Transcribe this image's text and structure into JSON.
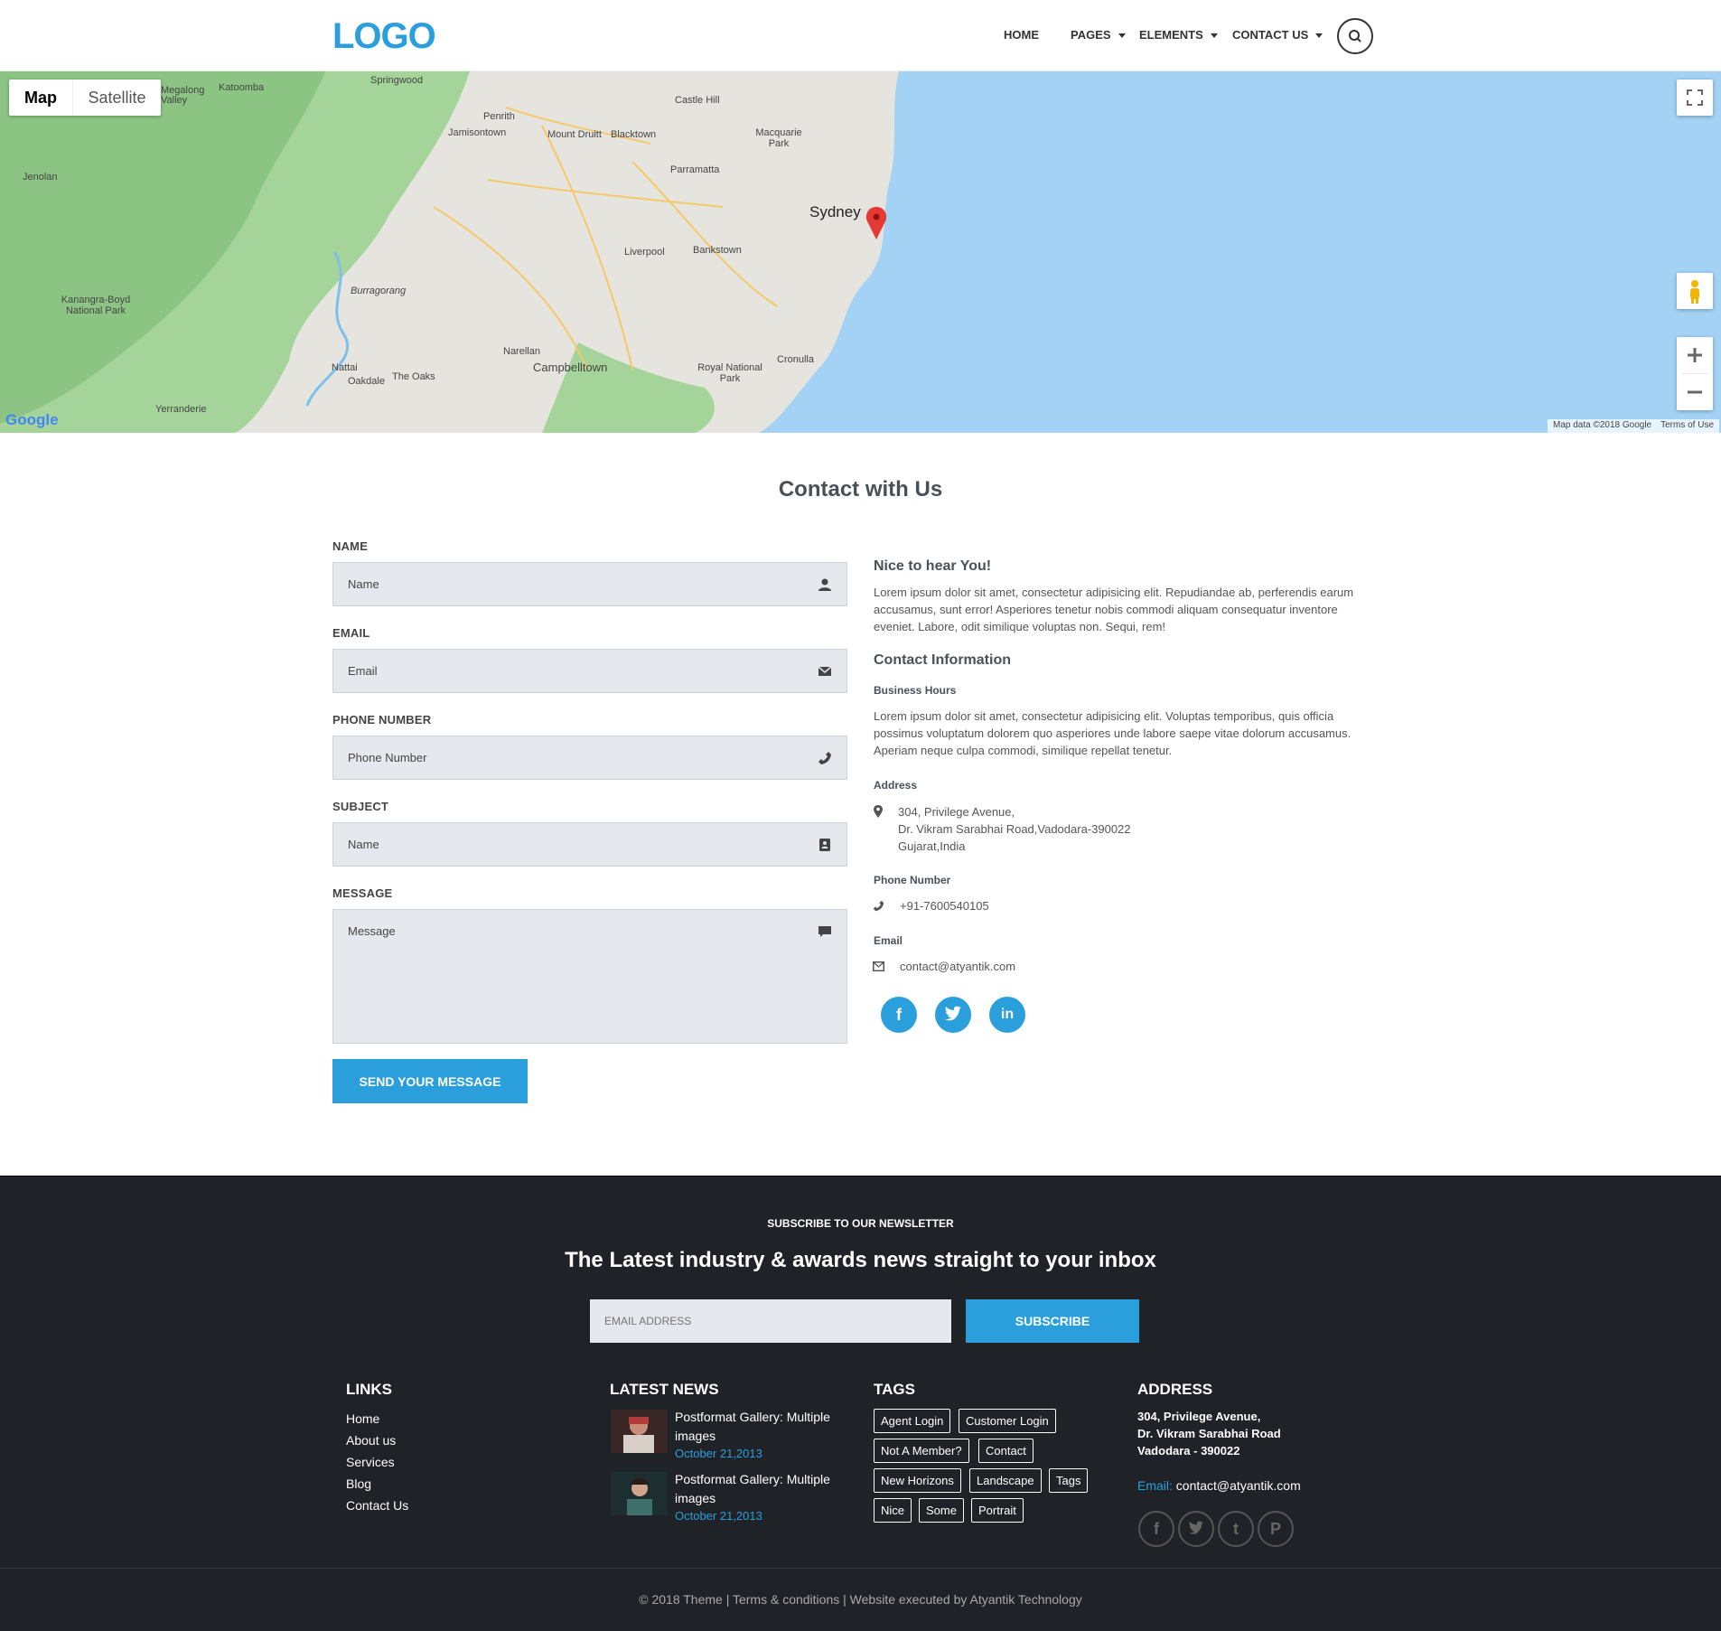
{
  "header": {
    "logo": "LOGO",
    "nav": [
      {
        "label": "HOME"
      },
      {
        "label": "PAGES"
      },
      {
        "label": "ELEMENTS"
      },
      {
        "label": "CONTACT US"
      }
    ]
  },
  "map": {
    "type_buttons": [
      "Map",
      "Satellite"
    ],
    "city_label": "Sydney",
    "places": [
      "Springwood",
      "Katoomba",
      "Megalong Valley",
      "Penrith",
      "Jamisontown",
      "Mount Druitt",
      "Blacktown",
      "Castle Hill",
      "Macquarie Park",
      "Parramatta",
      "Liverpool",
      "Bankstown",
      "Jenolan",
      "Kanangra-Boyd National Park",
      "Burragorang",
      "Narellan",
      "Campbelltown",
      "Cronulla",
      "Royal National Park",
      "Nattai",
      "Oakdale",
      "The Oaks",
      "Yerranderie"
    ],
    "attribution": "Map data ©2018 Google",
    "terms": "Terms of Use",
    "google": "Google"
  },
  "contact": {
    "title": "Contact with Us",
    "fields": [
      {
        "label": "NAME",
        "placeholder": "Name",
        "icon": "user-icon"
      },
      {
        "label": "EMAIL",
        "placeholder": "Email",
        "icon": "envelope-icon"
      },
      {
        "label": "PHONE NUMBER",
        "placeholder": "Phone Number",
        "icon": "phone-icon"
      },
      {
        "label": "SUBJECT",
        "placeholder": "Name",
        "icon": "address-book-icon"
      },
      {
        "label": "MESSAGE",
        "placeholder": "Message",
        "icon": "comment-icon"
      }
    ],
    "send_label": "SEND YOUR MESSAGE",
    "right": {
      "heading": "Nice to hear You!",
      "intro": "Lorem ipsum dolor sit amet, consectetur adipisicing elit. Repudiandae ab, perferendis earum accusamus, sunt error! Asperiores tenetur nobis commodi aliquam consequatur inventore eveniet. Labore, odit similique voluptas non. Sequi, rem!",
      "info_heading": "Contact Information",
      "hours_label": "Business Hours",
      "hours_text": "Lorem ipsum dolor sit amet, consectetur adipisicing elit. Voluptas temporibus, quis officia possimus voluptatum dolorem quo asperiores unde labore saepe vitae dolorum accusamus. Aperiam neque culpa commodi, similique repellat tenetur.",
      "address_label": "Address",
      "address_lines": [
        "304, Privilege Avenue,",
        "Dr. Vikram Sarabhai Road,Vadodara-390022",
        "Gujarat,India"
      ],
      "phone_label": "Phone Number",
      "phone": "+91-7600540105",
      "email_label": "Email",
      "email": "contact@atyantik.com"
    }
  },
  "newsletter": {
    "kicker": "SUBSCRIBE TO OUR NEWSLETTER",
    "headline": "The Latest industry & awards news straight to your inbox",
    "placeholder": "EMAIL ADDRESS",
    "button": "SUBSCRIBE"
  },
  "footer": {
    "links_title": "LINKS",
    "links": [
      "Home",
      "About us",
      "Services",
      "Blog",
      "Contact Us"
    ],
    "news_title": "LATEST NEWS",
    "news": [
      {
        "title": "Postformat Gallery: Multiple images",
        "date": "October 21,2013"
      },
      {
        "title": "Postformat Gallery: Multiple images",
        "date": "October 21,2013"
      }
    ],
    "tags_title": "TAGS",
    "tags": [
      "Agent Login",
      "Customer Login",
      "Not A Member?",
      "Contact",
      "New Horizons",
      "Landscape",
      "Tags",
      "Nice",
      "Some",
      "Portrait"
    ],
    "address_title": "ADDRESS",
    "address_lines": [
      "304, Privilege Avenue,",
      "Dr. Vikram Sarabhai Road",
      "Vadodara - 390022"
    ],
    "email_label": "Email:",
    "email": "contact@atyantik.com",
    "copyright": "© 2018 Theme | Terms & conditions | Website executed by Atyantik Technology"
  },
  "colors": {
    "accent": "#2a9fdc",
    "footer_bg": "#1f2226",
    "field_bg": "#e5e8ec"
  }
}
